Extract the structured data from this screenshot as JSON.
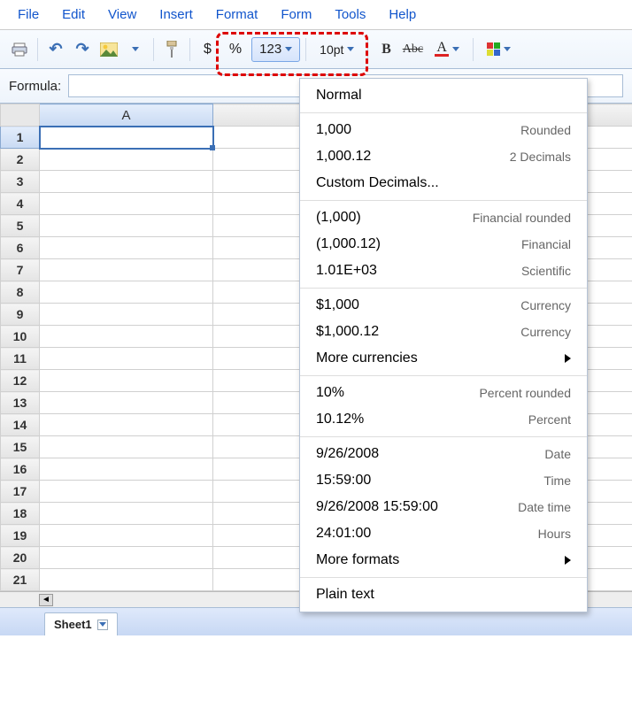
{
  "menubar": [
    "File",
    "Edit",
    "View",
    "Insert",
    "Format",
    "Form",
    "Tools",
    "Help"
  ],
  "toolbar": {
    "dollar": "$",
    "percent": "%",
    "n123": "123",
    "font_size": "10pt",
    "strike_label": "Abc",
    "textcolor_label": "A"
  },
  "formula": {
    "label": "Formula:",
    "value": ""
  },
  "columns": [
    "A"
  ],
  "rows": [
    1,
    2,
    3,
    4,
    5,
    6,
    7,
    8,
    9,
    10,
    11,
    12,
    13,
    14,
    15,
    16,
    17,
    18,
    19,
    20,
    21
  ],
  "sheet_tab": "Sheet1",
  "format_menu": {
    "groups": [
      [
        {
          "label": "Normal",
          "desc": ""
        }
      ],
      [
        {
          "label": "1,000",
          "desc": "Rounded"
        },
        {
          "label": "1,000.12",
          "desc": "2 Decimals"
        },
        {
          "label": "Custom Decimals...",
          "desc": ""
        }
      ],
      [
        {
          "label": "(1,000)",
          "desc": "Financial rounded"
        },
        {
          "label": "(1,000.12)",
          "desc": "Financial"
        },
        {
          "label": "1.01E+03",
          "desc": "Scientific"
        }
      ],
      [
        {
          "label": "$1,000",
          "desc": "Currency"
        },
        {
          "label": "$1,000.12",
          "desc": "Currency"
        },
        {
          "label": "More currencies",
          "desc": "",
          "submenu": true
        }
      ],
      [
        {
          "label": "10%",
          "desc": "Percent rounded"
        },
        {
          "label": "10.12%",
          "desc": "Percent"
        }
      ],
      [
        {
          "label": "9/26/2008",
          "desc": "Date"
        },
        {
          "label": "15:59:00",
          "desc": "Time"
        },
        {
          "label": "9/26/2008 15:59:00",
          "desc": "Date time"
        },
        {
          "label": "24:01:00",
          "desc": "Hours"
        },
        {
          "label": "More formats",
          "desc": "",
          "submenu": true
        }
      ],
      [
        {
          "label": "Plain text",
          "desc": ""
        }
      ]
    ]
  }
}
